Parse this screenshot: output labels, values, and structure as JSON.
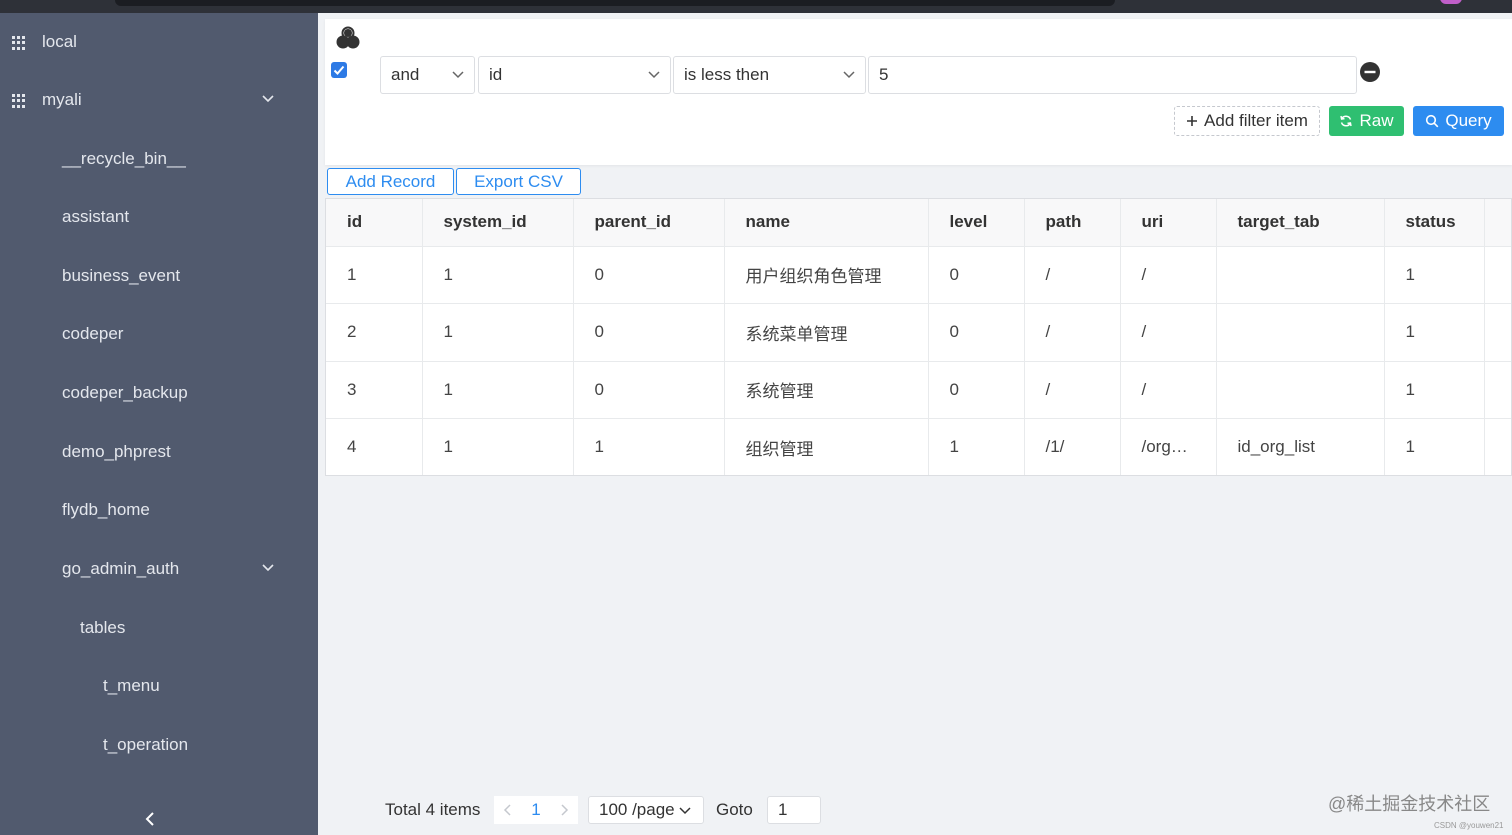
{
  "sidebar": {
    "items": [
      {
        "label": "local"
      },
      {
        "label": "myali"
      },
      {
        "label": "__recycle_bin__"
      },
      {
        "label": "assistant"
      },
      {
        "label": "business_event"
      },
      {
        "label": "codeper"
      },
      {
        "label": "codeper_backup"
      },
      {
        "label": "demo_phprest"
      },
      {
        "label": "flydb_home"
      },
      {
        "label": "go_admin_auth"
      },
      {
        "label": "tables"
      },
      {
        "label": "t_menu"
      },
      {
        "label": "t_operation"
      }
    ]
  },
  "filter": {
    "logic": "and",
    "field": "id",
    "operator": "is less then",
    "value": "5",
    "add_label": "Add filter item",
    "raw_label": "Raw",
    "query_label": "Query"
  },
  "toolbar": {
    "add_record": "Add Record",
    "export_csv": "Export CSV"
  },
  "table": {
    "columns": [
      "id",
      "system_id",
      "parent_id",
      "name",
      "level",
      "path",
      "uri",
      "target_tab",
      "status",
      ""
    ],
    "rows": [
      [
        "1",
        "1",
        "0",
        "用户组织角色管理",
        "0",
        "/",
        "/",
        "",
        "1",
        ""
      ],
      [
        "2",
        "1",
        "0",
        "系统菜单管理",
        "0",
        "/",
        "/",
        "",
        "1",
        ""
      ],
      [
        "3",
        "1",
        "0",
        "系统管理",
        "0",
        "/",
        "/",
        "",
        "1",
        ""
      ],
      [
        "4",
        "1",
        "1",
        "组织管理",
        "1",
        "/1/",
        "/org…",
        "id_org_list",
        "1",
        ""
      ]
    ]
  },
  "pager": {
    "total": "Total 4 items",
    "current_page": "1",
    "page_size": "100 /page",
    "goto_label": "Goto",
    "goto_value": "1"
  },
  "watermark": {
    "main": "@稀土掘金技术社区",
    "sub": "CSDN @youwen21"
  },
  "colors": {
    "sidebar_bg": "#515a6e",
    "primary": "#2d8cf0",
    "success": "#2fbf71"
  }
}
